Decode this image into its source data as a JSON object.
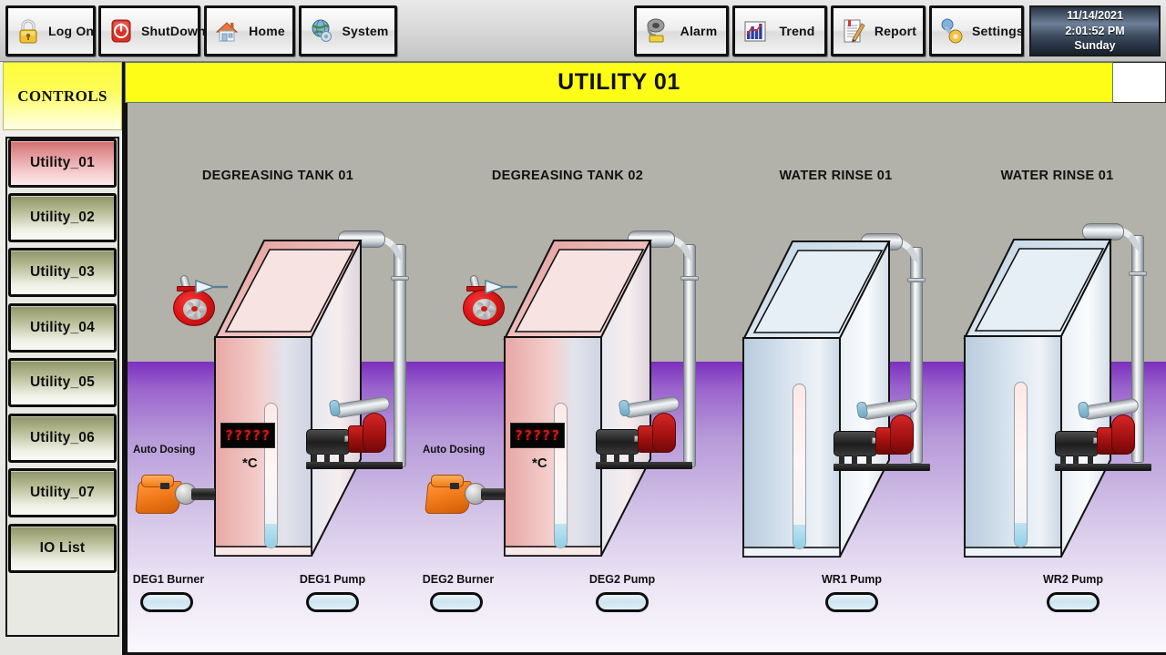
{
  "toolbar": {
    "buttons": [
      {
        "label": "Log On",
        "icon": "lock-icon"
      },
      {
        "label": "ShutDown",
        "icon": "power-icon"
      },
      {
        "label": "Home",
        "icon": "home-icon"
      },
      {
        "label": "System",
        "icon": "globe-icon"
      },
      {
        "label": "Alarm",
        "icon": "bell-icon"
      },
      {
        "label": "Trend",
        "icon": "bar-chart-icon"
      },
      {
        "label": "Report",
        "icon": "document-pencil-icon"
      },
      {
        "label": "Settings",
        "icon": "tools-icon"
      }
    ],
    "clock": {
      "date": "11/14/2021",
      "time": "2:01:52 PM",
      "day": "Sunday"
    }
  },
  "sidebar": {
    "header": "CONTROLS",
    "items": [
      {
        "label": "Utility_01",
        "active": true
      },
      {
        "label": "Utility_02",
        "active": false
      },
      {
        "label": "Utility_03",
        "active": false
      },
      {
        "label": "Utility_04",
        "active": false
      },
      {
        "label": "Utility_05",
        "active": false
      },
      {
        "label": "Utility_06",
        "active": false
      },
      {
        "label": "Utility_07",
        "active": false
      },
      {
        "label": "IO List",
        "active": false
      }
    ]
  },
  "page": {
    "title": "UTILITY 01"
  },
  "stations": [
    {
      "title": "DEGREASING TANK 01",
      "type": "heated",
      "temperature_value": "?????",
      "temperature_unit": "*C",
      "dosing_label": "Auto Dosing",
      "equipment": [
        {
          "label": "DEG1 Burner",
          "state": "off"
        },
        {
          "label": "DEG1 Pump",
          "state": "off"
        }
      ]
    },
    {
      "title": "DEGREASING TANK 02",
      "type": "heated",
      "temperature_value": "?????",
      "temperature_unit": "*C",
      "dosing_label": "Auto Dosing",
      "equipment": [
        {
          "label": "DEG2 Burner",
          "state": "off"
        },
        {
          "label": "DEG2 Pump",
          "state": "off"
        }
      ]
    },
    {
      "title": "WATER RINSE 01",
      "type": "rinse",
      "equipment": [
        {
          "label": "WR1 Pump",
          "state": "off"
        }
      ]
    },
    {
      "title": "WATER RINSE 01",
      "type": "rinse",
      "equipment": [
        {
          "label": "WR2 Pump",
          "state": "off"
        }
      ]
    }
  ],
  "colors": {
    "title_bar": "#fdfd18",
    "wall": "#b2b2aa",
    "floor_top": "#7c2fbe",
    "active_item": "#e39799",
    "inactive_item": "#b4b991",
    "status_pill": "#cde4f0",
    "temp_text": "#d21a1a"
  }
}
